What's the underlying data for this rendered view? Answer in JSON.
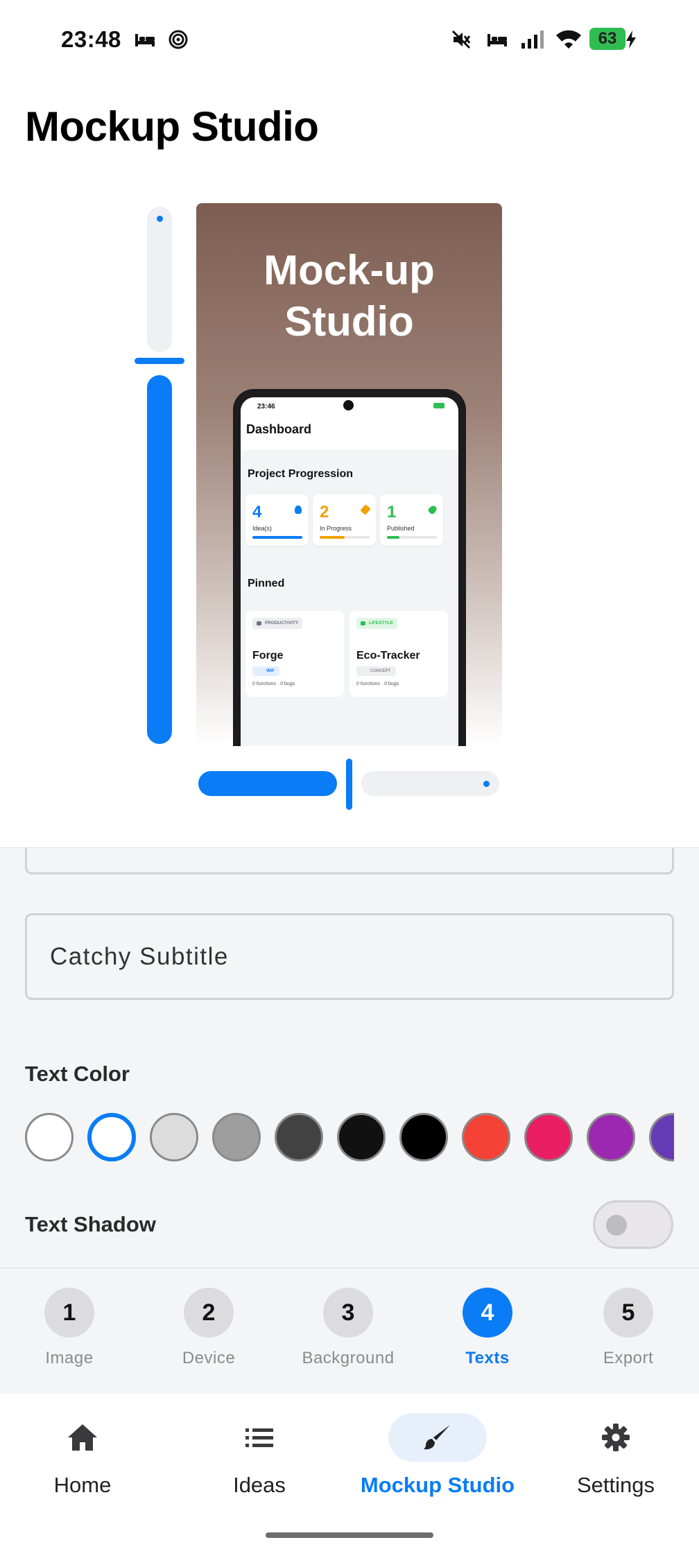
{
  "status_bar": {
    "time": "23:48",
    "left_icons": [
      "sleep-icon",
      "focus-icon"
    ],
    "right_icons": [
      "mute-icon",
      "sleep-icon",
      "signal-icon",
      "wifi-icon"
    ],
    "battery_level": "63",
    "charging": true
  },
  "page": {
    "title": "Mockup Studio"
  },
  "preview": {
    "title": "Mock-up\nStudio",
    "gradient_colors": [
      "#7e5d51",
      "#9c8176",
      "#cdbfb9",
      "#ffffff"
    ],
    "vertical_slider_level": 0.7,
    "horizontal_slider_level": 0.5,
    "phone_screen": {
      "time": "23:46",
      "header": "Dashboard",
      "section_progress": "Project Progression",
      "stats": [
        {
          "value": "4",
          "label": "Idea(s)",
          "color": "#0a7cf5",
          "icon": "lightbulb-icon",
          "progress": 1.0
        },
        {
          "value": "2",
          "label": "In Progress",
          "color": "#f2a100",
          "icon": "wrench-icon",
          "progress": 0.5
        },
        {
          "value": "1",
          "label": "Published",
          "color": "#2fbd52",
          "icon": "rocket-icon",
          "progress": 0.25
        }
      ],
      "section_pinned": "Pinned",
      "pinned": [
        {
          "category": "PRODUCTIVITY",
          "category_color": "#6d7280",
          "category_bg": "#eceef1",
          "name": "Forge",
          "tag": "WIP",
          "tag_color": "#0a7cf5",
          "tag_bg": "#e3efff",
          "meta": "0 functions · 0 bugs"
        },
        {
          "category": "LIFESTYLE",
          "category_color": "#2fbd52",
          "category_bg": "#e0f6e6",
          "name": "Eco-Tracker",
          "tag": "CONCEPT",
          "tag_color": "#8a8d93",
          "tag_bg": "#eceef1",
          "meta": "0 functions · 0 bugs"
        }
      ]
    }
  },
  "form": {
    "subtitle_placeholder": "Catchy Subtitle",
    "text_color_label": "Text Color",
    "text_colors": [
      "#ffffff",
      "#ffffff",
      "#dcdcdc",
      "#9e9e9e",
      "#424242",
      "#111111",
      "#000000",
      "#f44336",
      "#e91e63",
      "#9c27b0",
      "#673ab7"
    ],
    "selected_color_index": 1,
    "text_shadow_label": "Text Shadow",
    "text_shadow_enabled": false
  },
  "steps": [
    {
      "number": "1",
      "label": "Image"
    },
    {
      "number": "2",
      "label": "Device"
    },
    {
      "number": "3",
      "label": "Background"
    },
    {
      "number": "4",
      "label": "Texts",
      "active": true
    },
    {
      "number": "5",
      "label": "Export"
    }
  ],
  "nav": [
    {
      "label": "Home",
      "icon": "home-icon"
    },
    {
      "label": "Ideas",
      "icon": "list-icon"
    },
    {
      "label": "Mockup Studio",
      "icon": "brush-icon",
      "active": true
    },
    {
      "label": "Settings",
      "icon": "gear-icon"
    }
  ]
}
